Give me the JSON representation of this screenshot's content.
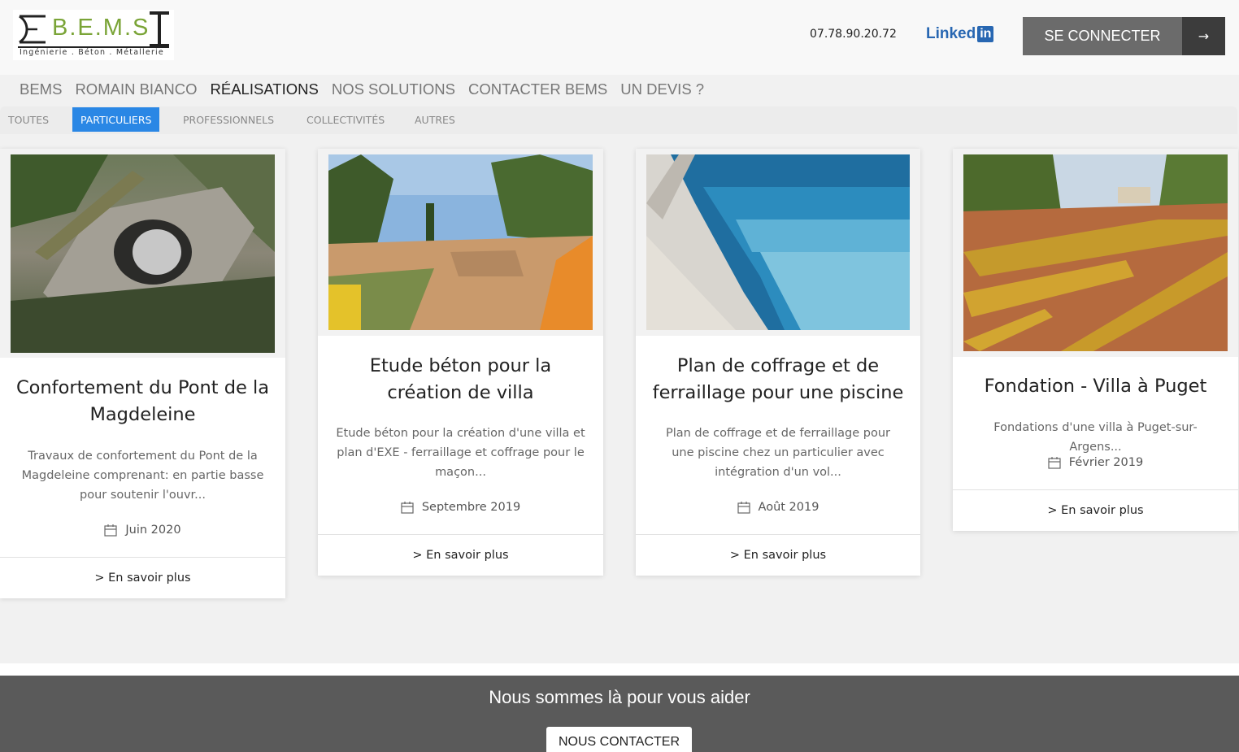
{
  "header": {
    "logo_text": "B.E.M.S",
    "logo_subtitle": "Ingénierie . Béton . Métallerie",
    "phone": "07.78.90.20.72",
    "linkedin_word": "Linked",
    "linkedin_box": "in",
    "login_label": "SE CONNECTER",
    "login_arrow": "→"
  },
  "nav": {
    "items": [
      {
        "label": "BEMS"
      },
      {
        "label": "ROMAIN BIANCO"
      },
      {
        "label": "RÉALISATIONS"
      },
      {
        "label": "NOS SOLUTIONS"
      },
      {
        "label": "CONTACTER BEMS"
      },
      {
        "label": "UN DEVIS ?"
      }
    ],
    "active": "RÉALISATIONS"
  },
  "filters": {
    "items": [
      {
        "label": "TOUTES"
      },
      {
        "label": "PARTICULIERS"
      },
      {
        "label": "PROFESSIONNELS"
      },
      {
        "label": "COLLECTIVITÉS"
      },
      {
        "label": "AUTRES"
      }
    ],
    "active": "PARTICULIERS"
  },
  "cards": [
    {
      "title": "Confortement du Pont de la Magdeleine",
      "description": "Travaux de confortement du Pont de la Magdeleine comprenant: en partie basse pour soutenir l'ouvr...",
      "date": "Juin 2020",
      "more": "> En savoir plus"
    },
    {
      "title": "Etude béton pour la création de villa",
      "description": "Etude béton pour la création d'une villa et plan d'EXE - ferraillage et coffrage pour le maçon...",
      "date": "Septembre 2019",
      "more": "> En savoir plus"
    },
    {
      "title": "Plan de coffrage et de ferraillage pour une piscine",
      "description": "Plan de coffrage et de ferraillage pour une piscine chez un particulier avec intégration d'un vol...",
      "date": "Août 2019",
      "more": "> En savoir plus"
    },
    {
      "title": "Fondation - Villa à Puget",
      "description": "Fondations d'une villa à Puget-sur-Argens...",
      "date": "Février 2019",
      "more": "> En savoir plus"
    }
  ],
  "footer": {
    "heading": "Nous sommes là pour vous aider",
    "button": "NOUS CONTACTER"
  },
  "colors": {
    "accent_blue": "#2a87e5",
    "logo_green": "#7aa437",
    "linkedin_blue": "#2867b2",
    "footer_bg": "#5a5a5a"
  }
}
